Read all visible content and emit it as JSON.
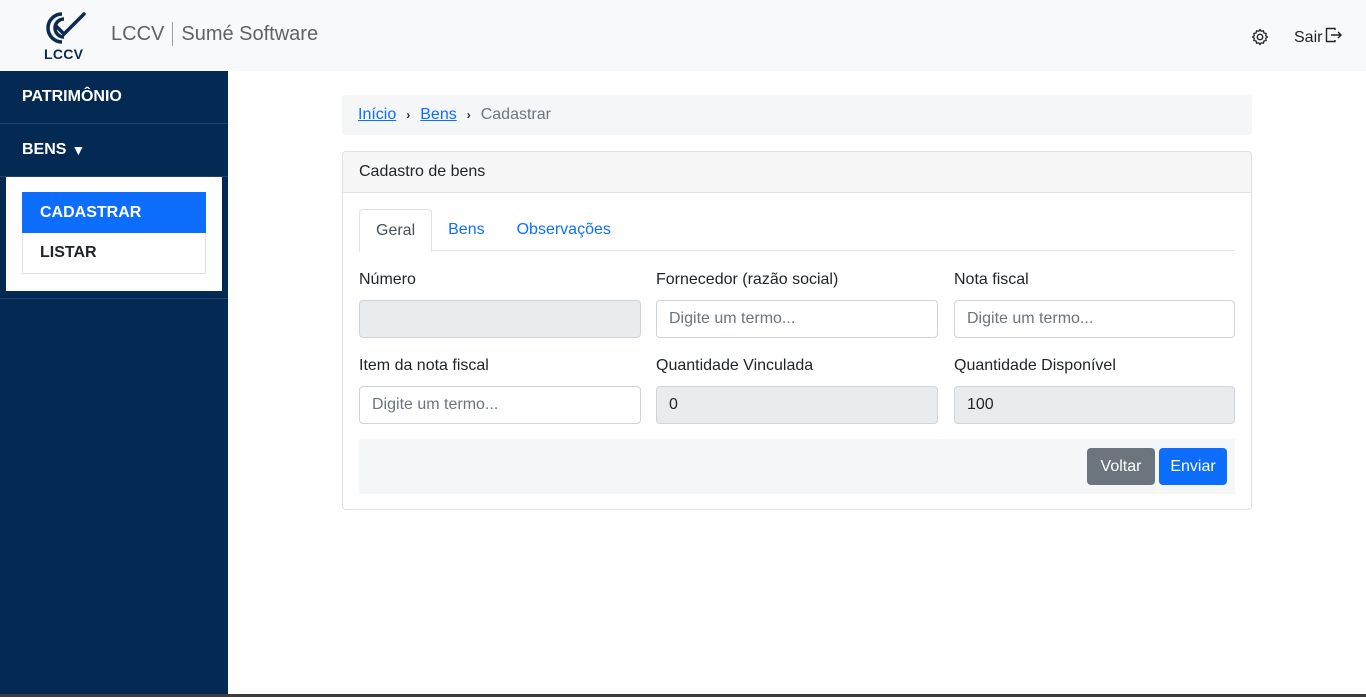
{
  "header": {
    "logo_text": "LCCV",
    "brand_left": "LCCV",
    "brand_right": "Sumé Software",
    "settings_icon": "gear-icon",
    "logout_label": "Sair",
    "logout_icon": "logout-icon"
  },
  "sidebar": {
    "items": [
      {
        "label": "PATRIMÔNIO"
      },
      {
        "label": "BENS",
        "caret": "▼"
      }
    ],
    "submenu": [
      {
        "label": "CADASTRAR",
        "active": true
      },
      {
        "label": "LISTAR",
        "active": false
      }
    ]
  },
  "breadcrumb": {
    "items": [
      "Início",
      "Bens"
    ],
    "current": "Cadastrar"
  },
  "card": {
    "title": "Cadastro de bens",
    "tabs": [
      "Geral",
      "Bens",
      "Observações"
    ],
    "fields": {
      "numero": {
        "label": "Número",
        "value": "",
        "placeholder": ""
      },
      "fornecedor": {
        "label": "Fornecedor (razão social)",
        "value": "",
        "placeholder": "Digite um termo..."
      },
      "nota_fiscal": {
        "label": "Nota fiscal",
        "value": "",
        "placeholder": "Digite um termo..."
      },
      "item_nota": {
        "label": "Item da nota fiscal",
        "value": "",
        "placeholder": "Digite um termo..."
      },
      "qtd_vinculada": {
        "label": "Quantidade Vinculada",
        "value": "0"
      },
      "qtd_disponivel": {
        "label": "Quantidade Disponível",
        "value": "100"
      }
    },
    "buttons": {
      "back": "Voltar",
      "submit": "Enviar"
    }
  }
}
